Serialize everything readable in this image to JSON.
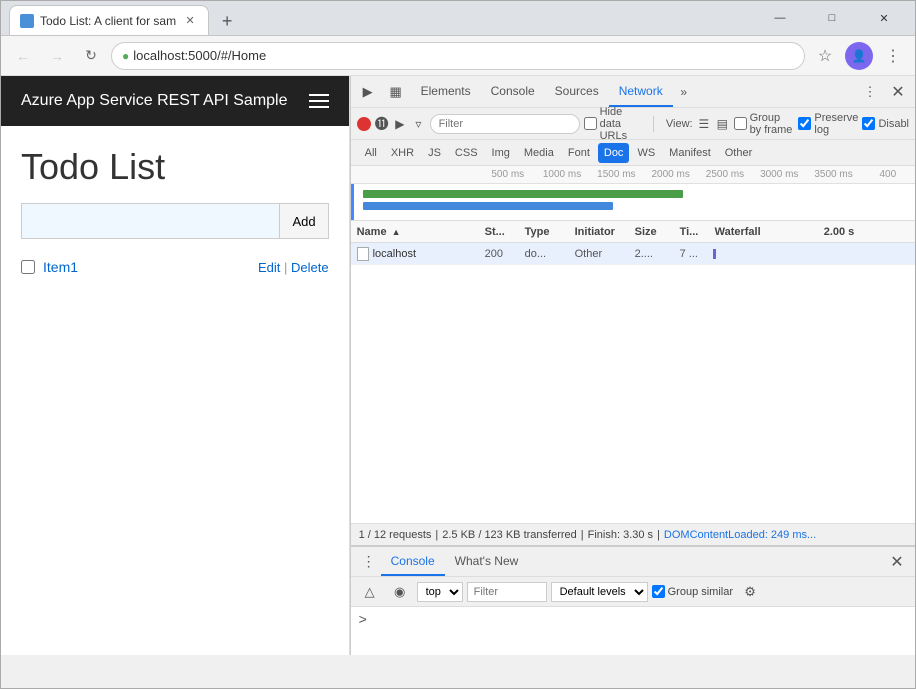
{
  "window": {
    "title": "Todo List: A client for sam",
    "controls": {
      "minimize": "—",
      "maximize": "□",
      "close": "✕"
    }
  },
  "browser": {
    "tab": {
      "title": "Todo List: A client for sam",
      "close": "✕"
    },
    "address": "localhost:5000/#/Home",
    "back_disabled": true,
    "forward_disabled": true
  },
  "webpage": {
    "app_title": "Azure App Service REST API Sample",
    "page_title": "Todo List",
    "input_placeholder": "",
    "add_button": "Add",
    "todo_items": [
      {
        "id": 1,
        "label": "Item1",
        "checked": false,
        "edit": "Edit",
        "delete": "Delete"
      }
    ]
  },
  "devtools": {
    "tabs": [
      "Elements",
      "Console",
      "Sources",
      "Network"
    ],
    "active_tab": "Network",
    "more_tabs": "»",
    "close": "✕",
    "network": {
      "filter_placeholder": "Filter",
      "hide_data_urls": "Hide data URLs",
      "view_label": "View:",
      "group_by_frame": "Group by frame",
      "preserve_log": "Preserve log",
      "disable": "Disabl",
      "filter_tabs": [
        "All",
        "XHR",
        "JS",
        "CSS",
        "Img",
        "Media",
        "Font",
        "Doc",
        "WS",
        "Manifest",
        "Other"
      ],
      "active_filter": "Doc",
      "timeline_ticks": [
        "500 ms",
        "1000 ms",
        "1500 ms",
        "2000 ms",
        "2500 ms",
        "3000 ms",
        "3500 ms",
        "400"
      ],
      "columns": {
        "name": "Name",
        "status": "St...",
        "type": "Type",
        "initiator": "Initiator",
        "size": "Size",
        "time": "Ti...",
        "waterfall": "Waterfall",
        "waterfall_time": "2.00 s"
      },
      "rows": [
        {
          "name": "localhost",
          "status": "200",
          "type": "do...",
          "initiator": "Other",
          "size": "2....",
          "time": "7 ..."
        }
      ],
      "status_bar": {
        "requests": "1 / 12 requests",
        "sep1": "|",
        "transferred": "2.5 KB / 123 KB transferred",
        "sep2": "|",
        "finish": "Finish: 3.30 s",
        "sep3": "|",
        "dom_content": "DOMContentLoaded: 249 ms..."
      }
    },
    "console": {
      "tabs": [
        "Console",
        "What's New"
      ],
      "active_tab": "Console",
      "close": "✕",
      "context": "top",
      "filter_placeholder": "Filter",
      "level": "Default levels",
      "group_similar": "Group similar",
      "prompt": ">"
    }
  }
}
